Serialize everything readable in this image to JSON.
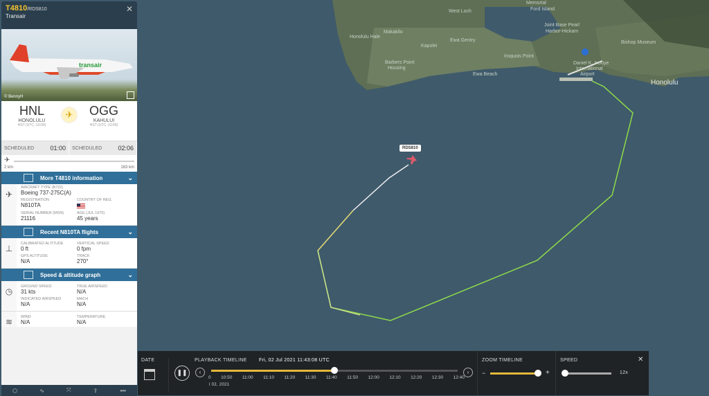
{
  "flight": {
    "number": "T4810",
    "callsign": "/RDS810",
    "airline": "Transair",
    "close": "✕"
  },
  "photo": {
    "credit": "© BennyH",
    "livery_text": "transair"
  },
  "route": {
    "origin": {
      "code": "HNL",
      "name": "HONOLULU",
      "tz": "HST (UTC -10:00)"
    },
    "destination": {
      "code": "OGG",
      "name": "KAHULUI",
      "tz": "HST (UTC -10:00)"
    },
    "dep_label": "SCHEDULED",
    "dep_time": "01:00",
    "arr_label": "SCHEDULED",
    "arr_time": "02:06",
    "dist_flown": "2 km",
    "dist_remaining": "163 km"
  },
  "sections": {
    "more_info": "More T4810 information",
    "recent": "Recent N810TA flights",
    "graph": "Speed & altitude graph"
  },
  "aircraft": {
    "type_label": "AIRCRAFT TYPE  (B732)",
    "type": "Boeing 737-275C(A)",
    "reg_label": "REGISTRATION",
    "reg": "N810TA",
    "country_label": "COUNTRY OF REG.",
    "msn_label": "SERIAL NUMBER (MSN)",
    "msn": "21116",
    "age_label": "AGE (JUL 1975)",
    "age": "45 years"
  },
  "alt": {
    "cal_label": "CALIBRATED ALTITUDE",
    "cal": "0 ft",
    "vs_label": "VERTICAL SPEED",
    "vs": "0 fpm",
    "gps_label": "GPS ALTITUDE",
    "gps": "N/A",
    "track_label": "TRACK",
    "track": "270°"
  },
  "speed": {
    "gs_label": "GROUND SPEED",
    "gs": "31 kts",
    "tas_label": "TRUE AIRSPEED",
    "tas": "N/A",
    "ias_label": "INDICATED AIRSPEED",
    "ias": "N/A",
    "mach_label": "MACH",
    "mach": "N/A",
    "wind_label": "WIND",
    "wind": "N/A",
    "temp_label": "TEMPERATURE",
    "temp": "N/A"
  },
  "map": {
    "callout": "RDS810",
    "places": [
      "West Loch",
      "Ford Island",
      "Joint Base Pearl",
      "Harbor-Hickam",
      "Honolulu Hale",
      "Makakilo",
      "Kapolei",
      "Ewa Gentry",
      "Iroquois Point",
      "Barbers Point",
      "Housing",
      "Ewa Beach",
      "Bishop Museum",
      "Honolulu",
      "Daniel K. Inouye",
      "International",
      "Airport",
      "Memorial"
    ]
  },
  "playback": {
    "date_label": "DATE",
    "timeline_label": "PLAYBACK TIMELINE",
    "datetime": "Fri, 02 Jul 2021 11:43:08 UTC",
    "ticks": [
      "0",
      "10:50",
      "11:00",
      "11:10",
      "11:20",
      "11:30",
      "11:40",
      "11:50",
      "12:00",
      "12:10",
      "12:20",
      "12:30",
      "12:40"
    ],
    "date_short": "l 02, 2021",
    "zoom_label": "ZOOM TIMELINE",
    "speed_label": "SPEED",
    "speed_value": "12x",
    "progress": 0.5
  }
}
